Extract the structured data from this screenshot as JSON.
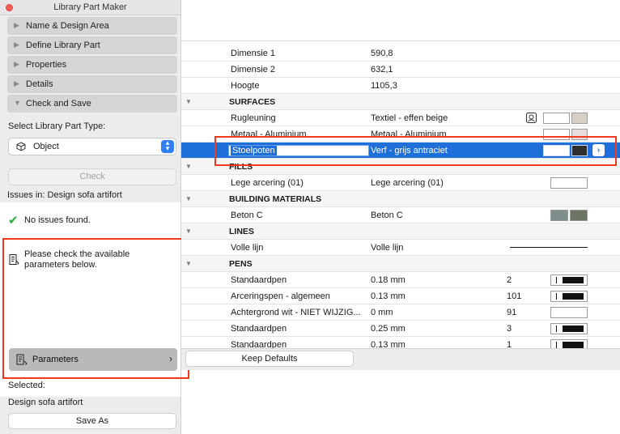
{
  "window": {
    "title": "Library Part Maker"
  },
  "steps": [
    {
      "label": "Name & Design Area"
    },
    {
      "label": "Define Library Part"
    },
    {
      "label": "Properties"
    },
    {
      "label": "Details"
    },
    {
      "label": "Check and Save"
    }
  ],
  "type_select": {
    "label": "Select Library Part Type:",
    "value": "Object"
  },
  "check_button": "Check",
  "issues": {
    "header": "Issues in: Design sofa artifort",
    "ok_text": "No issues found.",
    "message": "Please check the available parameters below.",
    "parameters_button": "Parameters"
  },
  "selected": {
    "label": "Selected:",
    "value": "Design sofa artifort"
  },
  "save_as_button": "Save As",
  "keep_defaults_button": "Keep Defaults",
  "table": {
    "rows": [
      {
        "name": "Dimensie 1",
        "value": "590,8"
      },
      {
        "name": "Dimensie 2",
        "value": "632,1"
      },
      {
        "name": "Hoogte",
        "value": "1105,3"
      },
      {
        "section": "SURFACES"
      },
      {
        "name": "Rugleuning",
        "value": "Textiel - effen beige"
      },
      {
        "name": "Metaal - Aluminium",
        "value": "Metaal - Aluminium"
      },
      {
        "name": "Stoelpoten",
        "value": "Verf - grijs antraciet"
      },
      {
        "section": "FILLS"
      },
      {
        "name": "Lege arcering (01)",
        "value": "Lege arcering (01)"
      },
      {
        "section": "BUILDING MATERIALS"
      },
      {
        "name": "Beton C",
        "value": "Beton C"
      },
      {
        "section": "LINES"
      },
      {
        "name": "Volle lijn",
        "value": "Volle lijn"
      },
      {
        "section": "PENS"
      },
      {
        "name": "Standaardpen",
        "value": "0.18 mm",
        "pen": "2"
      },
      {
        "name": "Arceringspen - algemeen",
        "value": "0.13 mm",
        "pen": "101"
      },
      {
        "name": "Achtergrond wit - NIET WIJZIG...",
        "value": "0 mm",
        "pen": "91"
      },
      {
        "name": "Standaardpen",
        "value": "0.25 mm",
        "pen": "3"
      },
      {
        "name": "Standaardpen",
        "value": "0.13 mm",
        "pen": "1"
      }
    ]
  },
  "colors": {
    "selection": "#1f6fdb",
    "highlight_box": "#f03a1f",
    "surface_beige": "#d7cfc6",
    "surface_alu": "#e6dedc",
    "surface_dark": "#2f2f2f",
    "concrete_a": "#7f8f8e",
    "concrete_b": "#6c7566",
    "accent": "#2f7ef5"
  },
  "icons": [
    "close-icon",
    "disclosure-triangle-icon",
    "object-icon",
    "chevron-updown-icon",
    "checkmark-icon",
    "document-icon",
    "parameters-icon",
    "chevron-right-icon",
    "material-preview-icon"
  ]
}
